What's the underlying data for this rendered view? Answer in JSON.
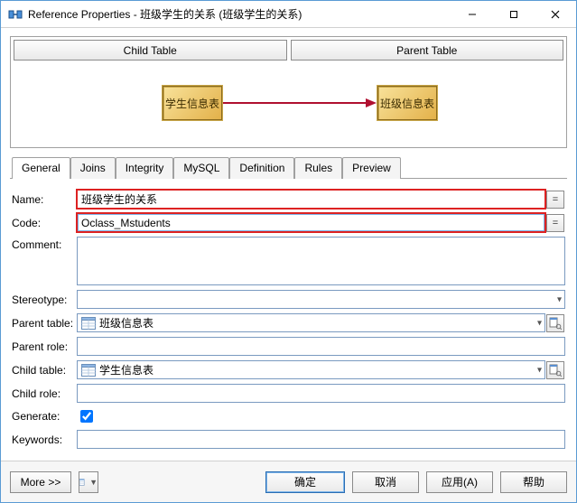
{
  "window": {
    "title": "Reference Properties - 班级学生的关系 (班级学生的关系)"
  },
  "diagram": {
    "child_btn": "Child Table",
    "parent_btn": "Parent Table",
    "child_box": "学生信息表",
    "parent_box": "班级信息表"
  },
  "tabs": {
    "general": "General",
    "joins": "Joins",
    "integrity": "Integrity",
    "mysql": "MySQL",
    "definition": "Definition",
    "rules": "Rules",
    "preview": "Preview"
  },
  "labels": {
    "name": "Name:",
    "code": "Code:",
    "comment": "Comment:",
    "stereotype": "Stereotype:",
    "parent_table": "Parent table:",
    "parent_role": "Parent role:",
    "child_table": "Child table:",
    "child_role": "Child role:",
    "generate": "Generate:",
    "keywords": "Keywords:"
  },
  "fields": {
    "name": "班级学生的关系",
    "code": "Oclass_Mstudents",
    "comment": "",
    "stereotype": "",
    "parent_table": "班级信息表",
    "parent_role": "",
    "child_table": "学生信息表",
    "child_role": "",
    "generate": true,
    "keywords": ""
  },
  "side_buttons": {
    "eq": "="
  },
  "footer": {
    "more": "More >>",
    "ok": "确定",
    "cancel": "取消",
    "apply": "应用(A)",
    "help": "帮助"
  }
}
